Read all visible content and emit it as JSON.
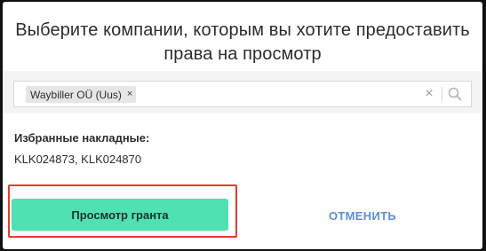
{
  "dialog": {
    "title_line1": "Выберите компании, которым вы хотите предоставить",
    "title_line2": "права на просмотр"
  },
  "company_selector": {
    "selected": [
      {
        "label": "Waybiller OÜ (Uus)",
        "remove_symbol": "×"
      }
    ],
    "clear_symbol": "×",
    "search_icon": "search-icon"
  },
  "favorites": {
    "label": "Избранные накладные:",
    "value": "KLK024873, KLK024870"
  },
  "actions": {
    "grant_label": "Просмотр гранта",
    "cancel_label": "ОТМЕНИТЬ"
  },
  "colors": {
    "grant_button": "#4fe0b4",
    "cancel_text": "#5b8ed6",
    "highlight_border": "#e53935"
  }
}
